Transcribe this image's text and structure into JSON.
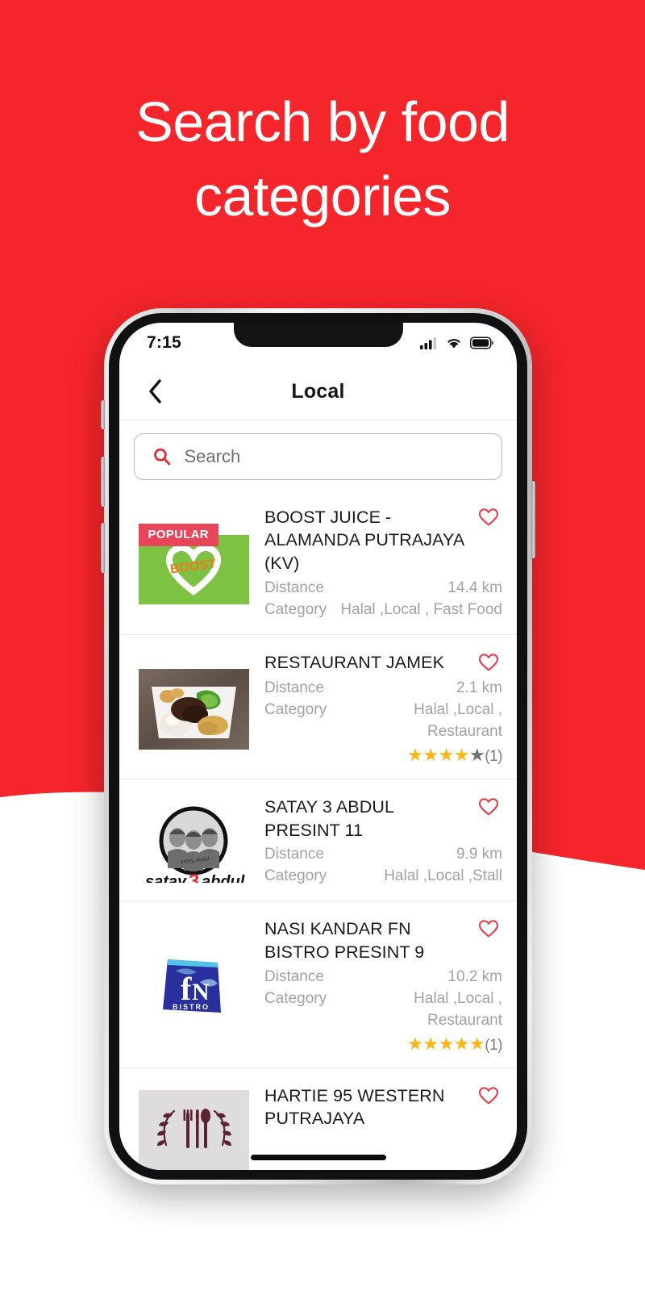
{
  "promo": {
    "headline_line1": "Search by food",
    "headline_line2": "categories",
    "background_color": "#F4252B"
  },
  "status_bar": {
    "time": "7:15",
    "signal_icon": "cellular-signal-icon",
    "wifi_icon": "wifi-icon",
    "battery_icon": "battery-icon"
  },
  "header": {
    "back_icon": "chevron-left-icon",
    "title": "Local"
  },
  "search": {
    "icon": "search-icon",
    "placeholder": "Search",
    "value": ""
  },
  "labels": {
    "distance": "Distance",
    "category": "Category",
    "favorite_icon": "heart-outline-icon"
  },
  "theme": {
    "accent_red": "#F4252B",
    "heart_red": "#E8404A",
    "badge_pink": "#E8455B",
    "star_gold": "#FBB615",
    "star_gray": "#6F7075",
    "muted_text": "#A2A2A6"
  },
  "listings": [
    {
      "name": "BOOST JUICE  -  ALAMANDA PUTRAJAYA (KV)",
      "badge": "POPULAR",
      "distance_label": "Distance",
      "distance": "14.4 km",
      "category_label": "Category",
      "category": "Halal ,Local , Fast Food",
      "rating": null,
      "rating_count": null,
      "thumb": "boost-juice-logo"
    },
    {
      "name": "RESTAURANT JAMEK",
      "badge": null,
      "distance_label": "Distance",
      "distance": "2.1 km",
      "category_label": "Category",
      "category": "Halal ,Local , Restaurant",
      "rating": 4,
      "rating_count": "(1)",
      "thumb": "nasi-lemak-plate-photo"
    },
    {
      "name": "SATAY 3 ABDUL PRESINT 11",
      "badge": null,
      "distance_label": "Distance",
      "distance": "9.9 km",
      "category_label": "Category",
      "category": "Halal ,Local ,Stall",
      "rating": null,
      "rating_count": null,
      "thumb": "satay-3-abdul-logo"
    },
    {
      "name": "NASI KANDAR FN BISTRO PRESINT 9",
      "badge": null,
      "distance_label": "Distance",
      "distance": "10.2 km",
      "category_label": "Category",
      "category": "Halal ,Local , Restaurant",
      "rating": 5,
      "rating_count": "(1)",
      "thumb": "fn-bistro-logo"
    },
    {
      "name": "HARTIE 95 WESTERN PUTRAJAYA",
      "badge": null,
      "distance_label": null,
      "distance": null,
      "category_label": null,
      "category": null,
      "rating": null,
      "rating_count": null,
      "thumb": "cutlery-laurel-logo"
    }
  ]
}
